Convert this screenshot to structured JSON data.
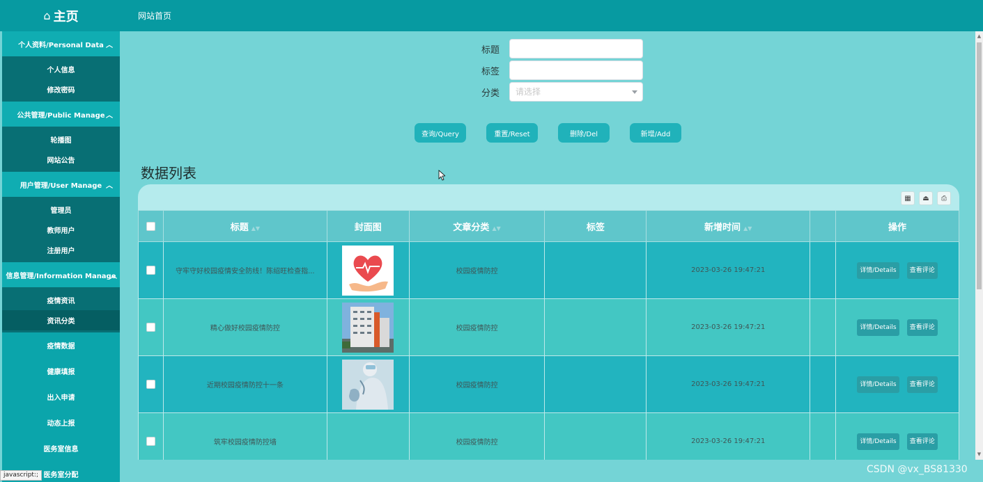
{
  "topbar": {
    "home_label": "主页",
    "home_icon": "house-icon",
    "site_home": "网站首页"
  },
  "sidebar": {
    "groups": [
      {
        "label": "个人资料/Personal Data",
        "items": [
          "个人信息",
          "修改密码"
        ]
      },
      {
        "label": "公共管理/Public Manage",
        "items": [
          "轮播图",
          "网站公告"
        ]
      },
      {
        "label": "用户管理/User Manage",
        "items": [
          "管理员",
          "教师用户",
          "注册用户"
        ]
      },
      {
        "label": "信息管理/Information Manage",
        "items": [
          "疫情资讯",
          "资讯分类"
        ]
      }
    ],
    "plain_items": [
      "疫情数据",
      "健康填报",
      "出入申请",
      "动态上报",
      "医务室信息",
      "医务室分配"
    ]
  },
  "search": {
    "title_label": "标题",
    "tag_label": "标签",
    "category_label": "分类",
    "category_placeholder": "请选择"
  },
  "buttons": {
    "query": "查询/Query",
    "reset": "重置/Reset",
    "delete": "删除/Del",
    "add": "新增/Add"
  },
  "list_title": "数据列表",
  "table": {
    "headers": [
      "标题",
      "封面图",
      "文章分类",
      "标签",
      "新增时间",
      "",
      "操作"
    ],
    "rows": [
      {
        "title": "守牢守好校园疫情安全防线！陈绍旺检查指...",
        "category": "校园疫情防控",
        "tag": "",
        "time": "2023-03-26 19:47:21",
        "cover": "heart-hand-image"
      },
      {
        "title": "精心做好校园疫情防控",
        "category": "校园疫情防控",
        "tag": "",
        "time": "2023-03-26 19:47:21",
        "cover": "building-image"
      },
      {
        "title": "近期校园疫情防控十一条",
        "category": "校园疫情防控",
        "tag": "",
        "time": "2023-03-26 19:47:21",
        "cover": "doctor-image"
      },
      {
        "title": "筑牢校园疫情防控墙",
        "category": "校园疫情防控",
        "tag": "",
        "time": "2023-03-26 19:47:21",
        "cover": ""
      }
    ],
    "details_label": "详情/Details",
    "comments_label": "查看评论"
  },
  "status_tip": "javascript:;",
  "watermark": "CSDN @vx_BS81330",
  "colors": {
    "topbar": "#079aa1",
    "sidebar": "#0ba5ab",
    "sidebar_sub": "#086f74",
    "main": "#74d4d6",
    "button": "#20b2ba"
  }
}
